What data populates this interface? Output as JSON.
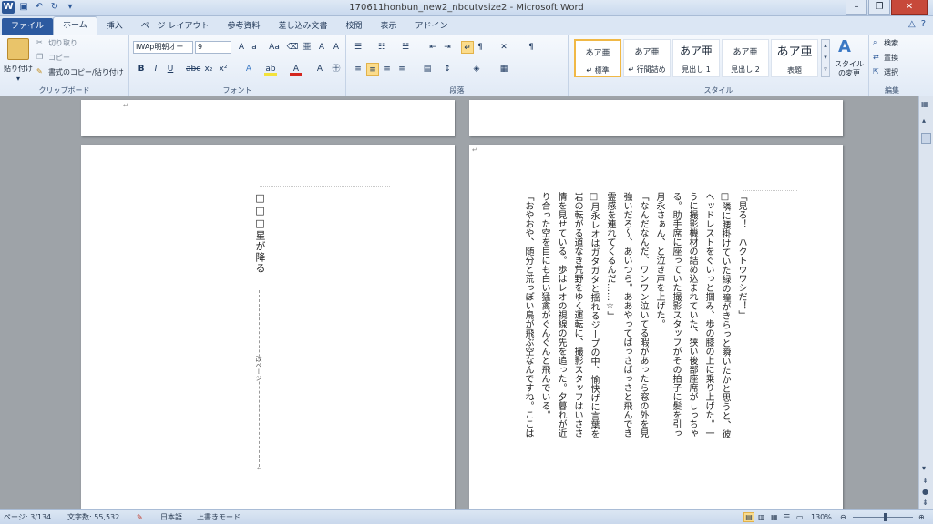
{
  "window": {
    "title": "170611honbun_new2_nbcutvsize2 - Microsoft Word"
  },
  "tabs": [
    {
      "label": "ファイル"
    },
    {
      "label": "ホーム"
    },
    {
      "label": "挿入"
    },
    {
      "label": "ページ レイアウト"
    },
    {
      "label": "参考資料"
    },
    {
      "label": "差し込み文書"
    },
    {
      "label": "校閲"
    },
    {
      "label": "表示"
    },
    {
      "label": "アドイン"
    }
  ],
  "ribbon": {
    "clipboard": {
      "paste": "貼り付け",
      "cut": "切り取り",
      "copy": "コピー",
      "format_painter": "書式のコピー/貼り付け",
      "label": "クリップボード"
    },
    "font": {
      "family": "IWAp明朝オー",
      "size": "9",
      "label": "フォント"
    },
    "paragraph": {
      "label": "段落"
    },
    "styles": {
      "items": [
        {
          "sample": "あア亜",
          "name": "↵ 標準"
        },
        {
          "sample": "あア亜",
          "name": "↵ 行間詰め"
        },
        {
          "sample": "あア亜",
          "name": "見出し 1"
        },
        {
          "sample": "あア亜",
          "name": "見出し 2"
        },
        {
          "sample": "あア亜",
          "name": "表題"
        }
      ],
      "change": "スタイルの変更",
      "label": "スタイル"
    },
    "editing": {
      "find": "検索",
      "replace": "置換",
      "select": "選択",
      "label": "編集"
    }
  },
  "document": {
    "left_page": {
      "heading": "□□□星が降る",
      "page_marker": "改ページ"
    },
    "right_page": {
      "lines": [
        "「見ろ！　ハクトウワシだ！」",
        "□隣に腰掛けていた緑の瞳がきらっと瞬いたかと思うと、彼",
        "ヘッドレストをぐいっと掴み、歩の膝の上に乗り上げた。一",
        "うに撮影機材の詰め込まれていた、狭い後部座席がしっちゃ",
        "る。助手席に座っていた撮影スタッフがその拍子に髪を引っ",
        "月永さぁん、と泣き声を上げた。",
        "「なんだなんだ、ワンワン泣いてる暇があったら窓の外を見",
        "強いだろ〜、あいつら。ああやってばっさばっさと飛んでき",
        "霊感を連れてくるんだ……☆」",
        "□月永レオはガタガタと揺れるジープの中、愉快げに言葉を",
        "岩の転がる道なき荒野をゆく運転に、撮影スタッフはいささ",
        "情を見せている。歩はレオの視線の先を追った。夕暮れが近",
        "り合った空を目にも白い猛禽がぐんぐんと飛んでいる。",
        "「おやおや、随分と荒っぽい鳥が飛ぶ空なんですね。ここは"
      ]
    }
  },
  "status": {
    "page": "ページ: 3/134",
    "words": "文字数: 55,532",
    "language": "日本語",
    "mode": "上書きモード",
    "zoom": "130%"
  }
}
